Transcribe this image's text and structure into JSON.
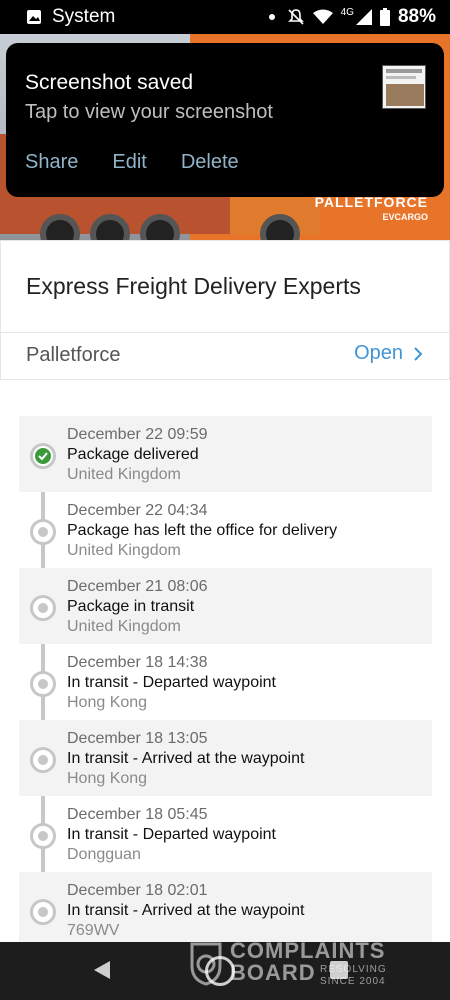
{
  "status_bar": {
    "app_label": "System",
    "network": "4G",
    "battery": "88%"
  },
  "notification": {
    "title": "Screenshot saved",
    "subtitle": "Tap to view your screenshot",
    "actions": [
      "Share",
      "Edit",
      "Delete"
    ]
  },
  "banner": {
    "logo_text": "PALLETFORCE",
    "logo_sub": "EVCARGO",
    "accent_color": "#e8742a"
  },
  "card": {
    "title": "Express Freight Delivery Experts",
    "carrier": "Palletforce",
    "open_label": "Open"
  },
  "timeline": [
    {
      "date": "December 22 09:59",
      "status": "Package delivered",
      "location": "United Kingdom",
      "state": "delivered"
    },
    {
      "date": "December 22 04:34",
      "status": "Package has left the office for delivery",
      "location": "United Kingdom",
      "state": "pending"
    },
    {
      "date": "December 21 08:06",
      "status": "Package in transit",
      "location": "United Kingdom",
      "state": "pending"
    },
    {
      "date": "December 18 14:38",
      "status": "In transit - Departed waypoint",
      "location": "Hong Kong",
      "state": "pending"
    },
    {
      "date": "December 18 13:05",
      "status": "In transit - Arrived at the waypoint",
      "location": "Hong Kong",
      "state": "pending"
    },
    {
      "date": "December 18 05:45",
      "status": "In transit - Departed waypoint",
      "location": "Dongguan",
      "state": "pending"
    },
    {
      "date": "December 18 02:01",
      "status": "In transit - Arrived at the waypoint",
      "location": "769WV",
      "state": "pending"
    }
  ],
  "watermark": {
    "line1": "COMPLAINTS",
    "line2": "BOARD",
    "right1": "RESOLVING",
    "right2": "SINCE 2004"
  },
  "colors": {
    "link": "#3f95d6",
    "delivered_check": "#3a9a3a"
  }
}
